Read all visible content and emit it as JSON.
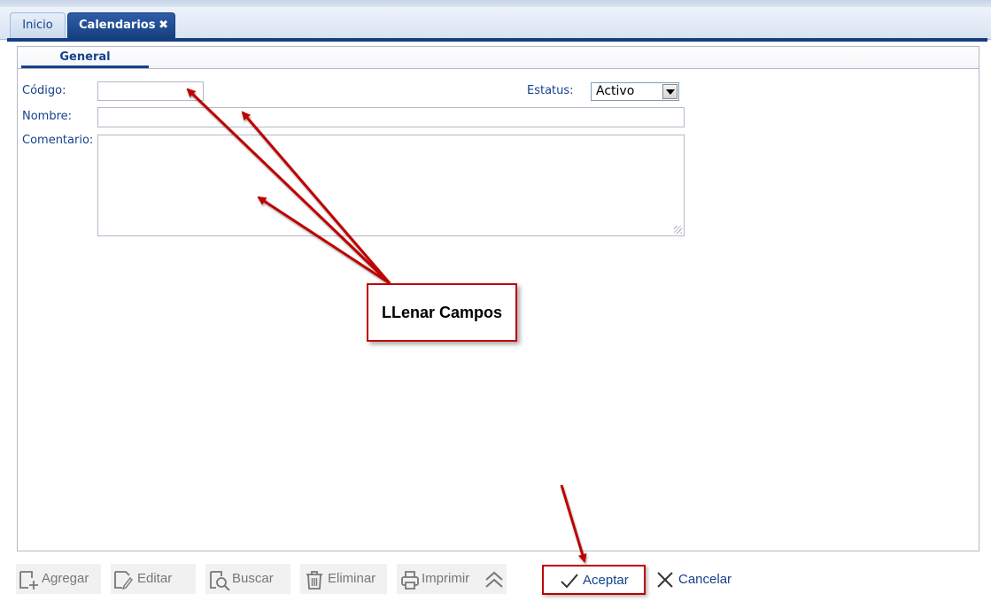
{
  "tabs": [
    {
      "label": "Inicio"
    },
    {
      "label": "Calendarios",
      "close": "✖"
    }
  ],
  "subtabs": [
    {
      "label": "General"
    }
  ],
  "form": {
    "codigo_label": "Código:",
    "codigo_value": "",
    "estatus_label": "Estatus:",
    "estatus_value": "Activo",
    "nombre_label": "Nombre:",
    "nombre_value": "",
    "comentario_label": "Comentario:",
    "comentario_value": ""
  },
  "annotation": {
    "text": "LLenar Campos",
    "color": "#c00000"
  },
  "toolbar": {
    "agregar": "Agregar",
    "editar": "Editar",
    "buscar": "Buscar",
    "eliminar": "Eliminar",
    "imprimir": "Imprimir",
    "aceptar": "Aceptar",
    "cancelar": "Cancelar"
  },
  "icons": [
    "close-icon",
    "add-icon",
    "edit-icon",
    "search-icon",
    "trash-icon",
    "printer-icon",
    "collapse-up-icon",
    "check-icon",
    "x-icon",
    "resize-grip-icon",
    "dropdown-arrow-icon"
  ],
  "colors": {
    "accent": "#15428b",
    "tab_active": "#163f80",
    "annotation": "#c00000"
  }
}
